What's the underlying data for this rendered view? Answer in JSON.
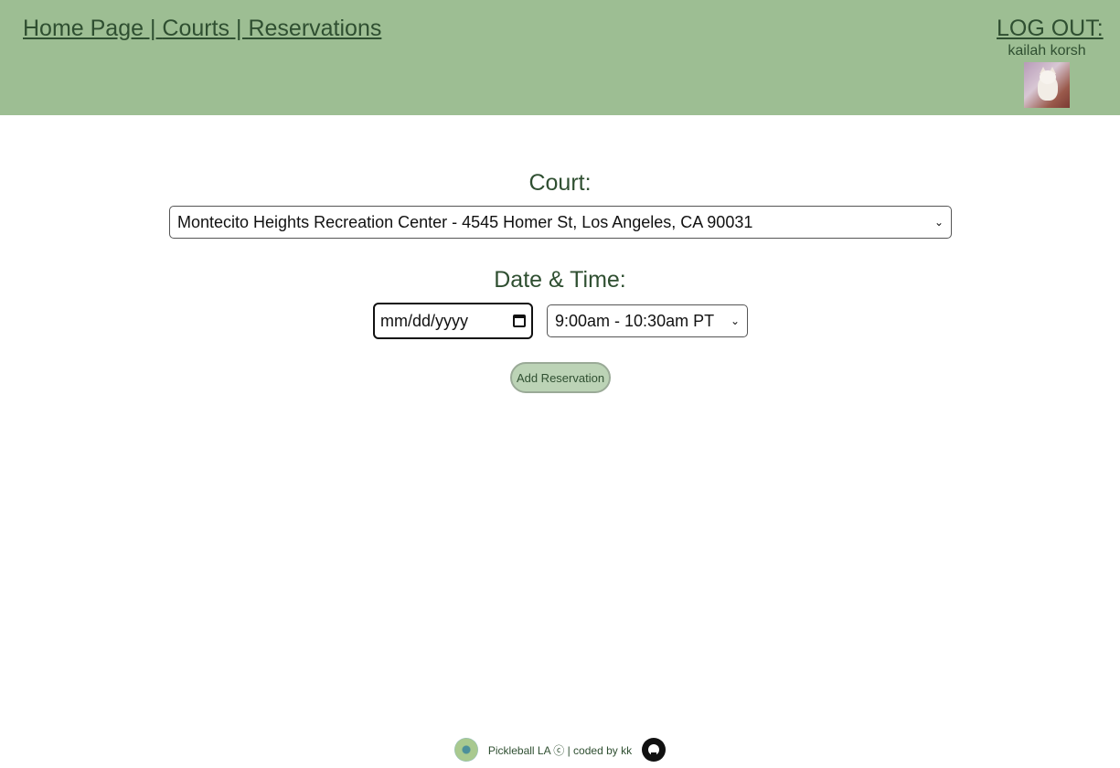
{
  "header": {
    "nav": {
      "home": "Home Page",
      "sep1": " | ",
      "courts": "Courts",
      "sep2": " | ",
      "reservations": "Reservations"
    },
    "logout_label": "LOG OUT:",
    "username": "kailah korsh"
  },
  "form": {
    "court_label": "Court:",
    "court_selected": "Montecito Heights Recreation Center - 4545 Homer St, Los Angeles, CA 90031",
    "datetime_label": "Date & Time:",
    "date_placeholder": "mm/dd/yyyy",
    "time_selected": "9:00am - 10:30am PT",
    "submit_label": "Add Reservation"
  },
  "footer": {
    "text": "Pickleball LA ⓒ | coded by kk"
  },
  "colors": {
    "header_bg": "#9dbe93",
    "text_green": "#2f4f31",
    "button_bg": "#bcd3b6"
  }
}
